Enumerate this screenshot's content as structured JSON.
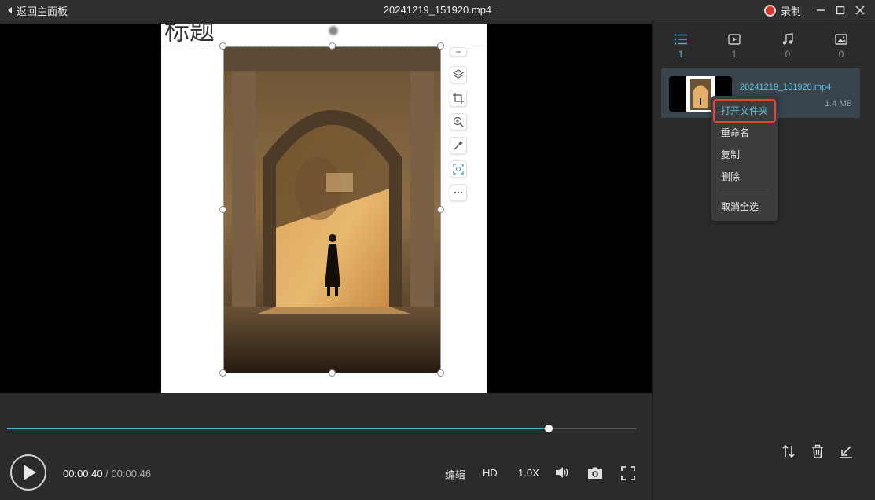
{
  "titlebar": {
    "back_label": "返回主面板",
    "title": "20241219_151920.mp4",
    "record_label": "录制"
  },
  "stage": {
    "page_title": "标题"
  },
  "player": {
    "progress": 0.86,
    "current_time": "00:00:40",
    "separator": " / ",
    "total_time": "00:00:46",
    "edit_label": "编辑",
    "quality_label": "HD",
    "speed_label": "1.0X"
  },
  "tabs": [
    {
      "icon": "list-icon",
      "count": "1",
      "active": true
    },
    {
      "icon": "video-icon",
      "count": "1",
      "active": false
    },
    {
      "icon": "music-icon",
      "count": "0",
      "active": false
    },
    {
      "icon": "image-icon",
      "count": "0",
      "active": false
    }
  ],
  "file": {
    "name": "20241219_151920.mp4",
    "size": "1.4 MB"
  },
  "context_menu": {
    "open_folder": "打开文件夹",
    "rename": "重命名",
    "copy": "复制",
    "delete": "删除",
    "deselect_all": "取消全选"
  },
  "colors": {
    "accent": "#3fb9d6",
    "highlight_box": "#e2433a",
    "record": "#d8392c"
  }
}
